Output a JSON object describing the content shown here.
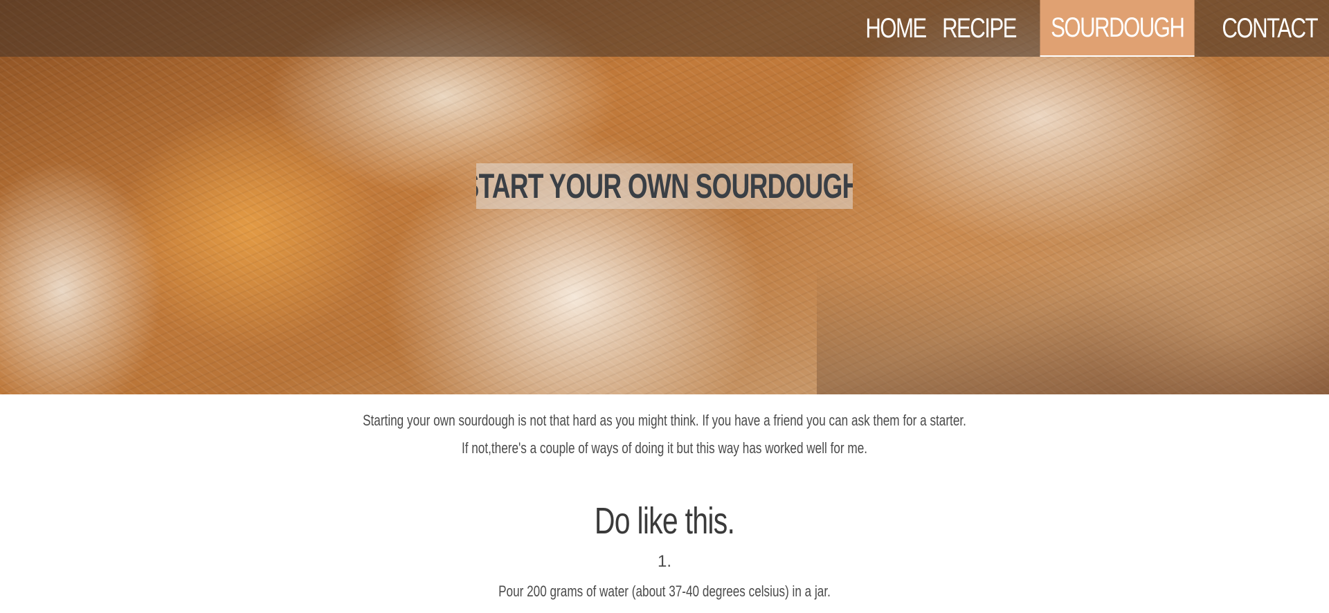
{
  "nav": {
    "items": [
      {
        "label": "HOME",
        "active": false
      },
      {
        "label": "RECIPE",
        "active": false
      },
      {
        "label": "SOURDOUGH",
        "active": true
      },
      {
        "label": "CONTACT",
        "active": false
      }
    ],
    "active_color": "#e0a172"
  },
  "hero": {
    "title": "START YOUR OWN SOURDOUGH."
  },
  "intro": {
    "line1": "Starting your own sourdough is not that hard as you might think. If you have a friend you can ask them for a starter.",
    "line2": "If not,there's a couple of ways of doing it but this way has worked well for me."
  },
  "section": {
    "title": "Do like this.",
    "steps": [
      {
        "number": "1.",
        "text": "Pour 200 grams of water (about 37-40 degrees celsius) in a jar."
      }
    ]
  }
}
